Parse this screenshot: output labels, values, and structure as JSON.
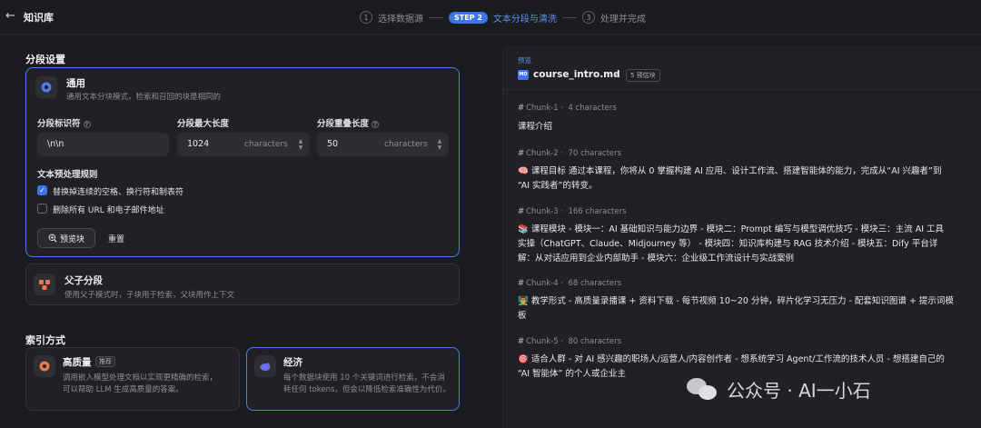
{
  "header": {
    "back_icon": "arrow-left-icon",
    "title": "知识库",
    "steps": [
      {
        "num": "1",
        "label": "选择数据源"
      },
      {
        "pill": "STEP 2",
        "label": "文本分段与清洗"
      },
      {
        "num": "3",
        "label": "处理并完成"
      }
    ]
  },
  "segment": {
    "heading": "分段设置",
    "general": {
      "title": "通用",
      "desc": "通用文本分块模式，检索和召回的块是相同的",
      "separator_label": "分段标识符",
      "separator_value": "\\n\\n",
      "max_len_label": "分段最大长度",
      "max_len_value": "1024",
      "max_len_unit": "characters",
      "overlap_label": "分段重叠长度",
      "overlap_value": "50",
      "overlap_unit": "characters",
      "rules_heading": "文本预处理规则",
      "rule1": "替换掉连续的空格、换行符和制表符",
      "rule1_checked": true,
      "rule2": "删除所有 URL 和电子邮件地址",
      "rule2_checked": false,
      "preview_btn": "预览块",
      "reset_btn": "重置"
    },
    "parent_child": {
      "title": "父子分段",
      "desc": "使用父子模式时，子块用于检索，父块用作上下文"
    }
  },
  "index": {
    "heading": "索引方式",
    "hq": {
      "title": "高质量",
      "badge": "推荐",
      "desc1": "调用嵌入模型处理文档以实现更精确的检索，",
      "desc2": "可以帮助 LLM 生成高质量的答案。"
    },
    "eco": {
      "title": "经济",
      "desc1": "每个数据块使用 10 个关键词进行检索，不会消",
      "desc2": "耗任何 tokens，但会以降低检索准确性为代价。"
    }
  },
  "preview": {
    "tag": "预览",
    "file_icon": "MD",
    "file_name": "course_intro.md",
    "chunk_count": "5 预估块",
    "chunks": [
      {
        "id": "Chunk-1",
        "chars": "4 characters",
        "lines": [
          "课程介绍"
        ]
      },
      {
        "id": "Chunk-2",
        "chars": "70 characters",
        "lines": [
          "🧠 课程目标 通过本课程，你将从 0 掌握构建 AI 应用、设计工作流、搭建智能体的能力，完成从“AI 兴趣者”到",
          "“AI 实践者”的转变。"
        ]
      },
      {
        "id": "Chunk-3",
        "chars": "166 characters",
        "lines": [
          "📚 课程模块 - 模块一：AI 基础知识与能力边界 - 模块二：Prompt 编写与模型调优技巧 - 模块三：主流 AI 工具",
          "实操（ChatGPT、Claude、Midjourney 等） - 模块四：知识库构建与 RAG 技术介绍 - 模块五：Dify 平台详",
          "解：从对话应用到企业内部助手 - 模块六：企业级工作流设计与实战案例"
        ]
      },
      {
        "id": "Chunk-4",
        "chars": "68 characters",
        "lines": [
          "👨‍🏫 教学形式 - 高质量录播课 + 资料下载 - 每节视频 10~20 分钟，碎片化学习无压力 - 配套知识图谱 + 提示词模",
          "板"
        ]
      },
      {
        "id": "Chunk-5",
        "chars": "80 characters",
        "lines": [
          "🎯 适合人群 - 对 AI 感兴趣的职场人/运营人/内容创作者 - 想系统学习 Agent/工作流的技术人员 - 想搭建自己的",
          "“AI 智能体” 的个人或企业主"
        ]
      }
    ]
  },
  "watermark": "公众号 · AI一小石"
}
